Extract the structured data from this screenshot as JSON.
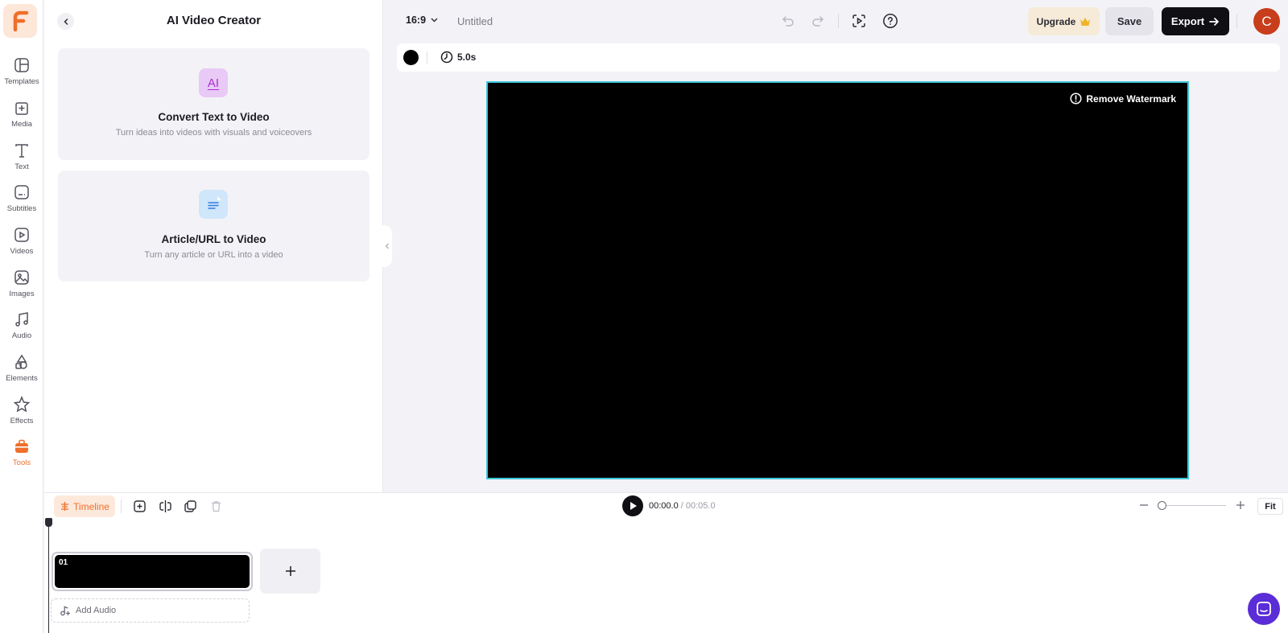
{
  "colors": {
    "accent": "#ef6f2b",
    "canvas_border": "#41c6da",
    "chat": "#5a2dd6",
    "avatar": "#c83d1b"
  },
  "brand": {
    "logo_icon": "brand-f-logo-icon"
  },
  "rail": {
    "items": [
      {
        "label": "Templates",
        "icon": "templates-icon"
      },
      {
        "label": "Media",
        "icon": "media-plus-icon"
      },
      {
        "label": "Text",
        "icon": "text-icon"
      },
      {
        "label": "Subtitles",
        "icon": "subtitles-icon"
      },
      {
        "label": "Videos",
        "icon": "video-play-icon"
      },
      {
        "label": "Images",
        "icon": "image-icon"
      },
      {
        "label": "Audio",
        "icon": "music-note-icon"
      },
      {
        "label": "Elements",
        "icon": "shapes-icon"
      },
      {
        "label": "Effects",
        "icon": "sparkle-icon"
      },
      {
        "label": "Tools",
        "icon": "toolbox-icon",
        "active": true
      }
    ]
  },
  "panel": {
    "title": "AI Video Creator",
    "cards": [
      {
        "icon_text": "AI",
        "title": "Convert Text to Video",
        "subtitle": "Turn ideas into videos with visuals and voiceovers"
      },
      {
        "icon": "document-icon",
        "title": "Article/URL to Video",
        "subtitle": "Turn any article or URL into a video"
      }
    ]
  },
  "topbar": {
    "aspect_ratio": "16:9",
    "doc_title": "Untitled",
    "upgrade_label": "Upgrade",
    "save_label": "Save",
    "export_label": "Export",
    "avatar_initial": "C"
  },
  "scene_props": {
    "duration": "5.0s",
    "background_color": "#000000"
  },
  "canvas": {
    "watermark_label": "Remove Watermark"
  },
  "timeline": {
    "tab_label": "Timeline",
    "current_time": "00:00.0",
    "total_time": " / 00:05.0",
    "fit_label": "Fit",
    "clips": [
      {
        "number": "01"
      }
    ],
    "add_audio_label": "Add Audio"
  }
}
